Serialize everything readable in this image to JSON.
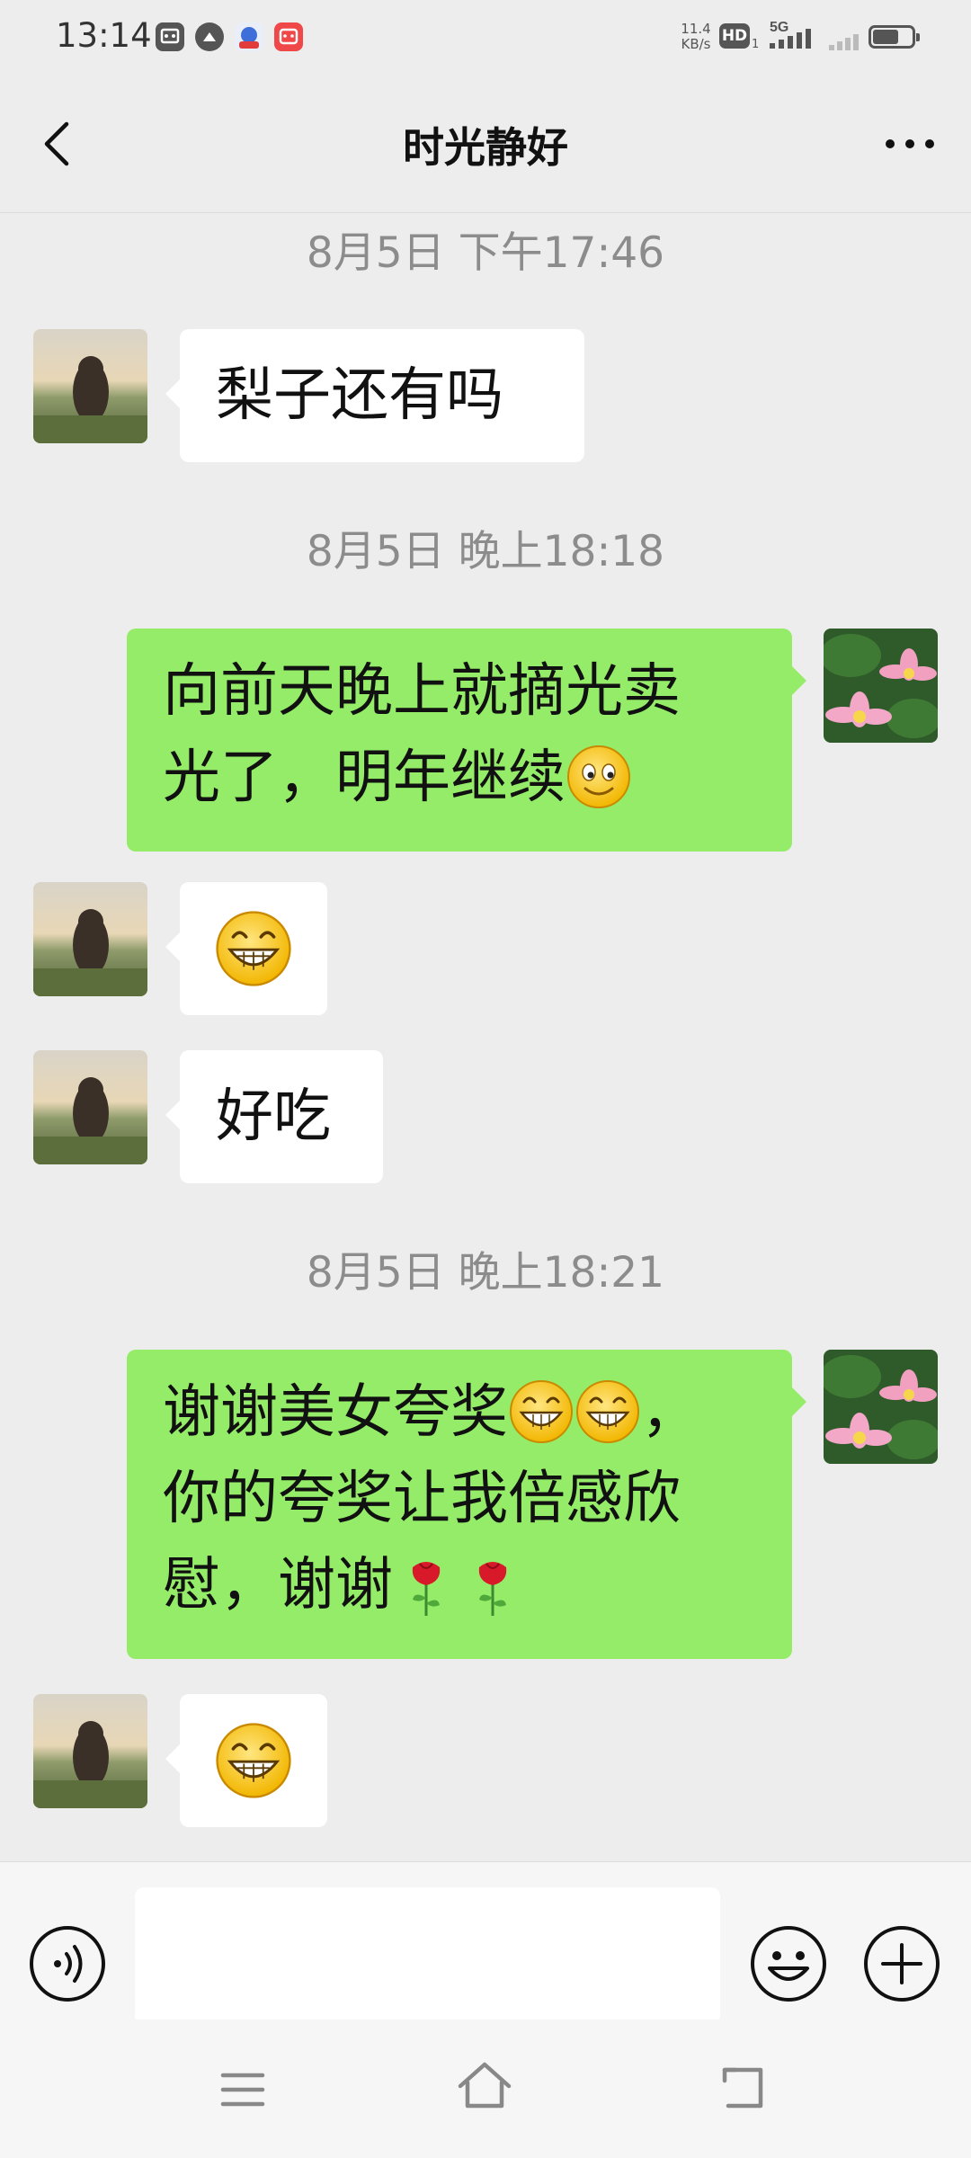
{
  "status_bar": {
    "time": "13:14",
    "net_speed_value": "11.4",
    "net_speed_unit": "KB/s",
    "hd": "HD",
    "hd_sub": "1",
    "network": "5G",
    "icons": [
      "app-icon-1",
      "app-icon-2",
      "app-icon-3",
      "app-icon-4"
    ]
  },
  "header": {
    "title": "时光静好",
    "back_icon": "chevron-left-icon",
    "more_icon": "more-dots-icon"
  },
  "messages": [
    {
      "type": "time",
      "text": "8月5日 下午17:46"
    },
    {
      "type": "msg",
      "side": "left",
      "text": "梨子还有吗"
    },
    {
      "type": "time",
      "text": "8月5日 晚上18:18"
    },
    {
      "type": "msg",
      "side": "right",
      "line1": "向前天晚上就摘光卖",
      "line2": "光了，明年继续",
      "emoji": "smile-emoji"
    },
    {
      "type": "msg",
      "side": "left",
      "emoji": "grin-emoji"
    },
    {
      "type": "msg",
      "side": "left",
      "text": "好吃"
    },
    {
      "type": "time",
      "text": "8月5日 晚上18:21"
    },
    {
      "type": "msg",
      "side": "right",
      "line1_a": "谢谢美女夸奖",
      "line1_b": "，",
      "line2": "你的夸奖让我倍感欣",
      "line3": "慰，谢谢",
      "emoji": [
        "grin-emoji",
        "grin-emoji",
        "rose-emoji",
        "rose-emoji"
      ]
    },
    {
      "type": "msg",
      "side": "left",
      "emoji": "grin-emoji"
    }
  ],
  "input_bar": {
    "placeholder": "",
    "voice_icon": "voice-icon",
    "emoji_icon": "emoji-icon",
    "plus_icon": "plus-icon"
  },
  "system_nav": {
    "icons": [
      "menu-icon",
      "home-icon",
      "back-icon"
    ]
  },
  "colors": {
    "background": "#ededed",
    "bubble_self": "#95ec69",
    "bubble_other": "#ffffff",
    "timestamp": "#8c8c8c"
  }
}
